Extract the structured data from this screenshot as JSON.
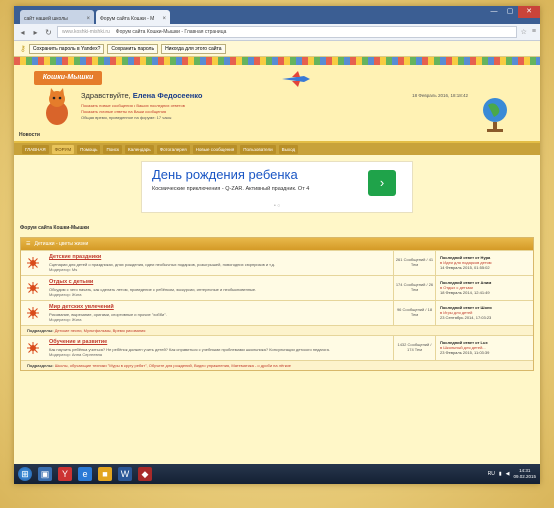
{
  "browser": {
    "tabs": [
      {
        "label": "сайт нашей школы",
        "active": false
      },
      {
        "label": "Форум сайта Кошки - М",
        "active": true
      }
    ],
    "address": {
      "host": "www.koshki-mishki.ru",
      "title": "Форум сайта Кошки-Мышки - Главная страница"
    },
    "password_bar": {
      "prompt": "Сохранить пароль в Yandex?",
      "save_label": "Сохранить пароль",
      "never_label": "Никогда для этого сайта"
    }
  },
  "site": {
    "logo": "Кошки-Мышки",
    "greeting": "Здравствуйте,",
    "user_name": "Елена Федосеенко",
    "links": [
      "Показать новые сообщения • Ваших последних ответов",
      "Показать личные ответы на Ваши сообщения",
      "Общая время, проведенное на форуме: 17 часы"
    ],
    "date": "18 Февраль 2016, 18:18:42",
    "news_label": "Новости",
    "nav": [
      "ГЛАВНАЯ",
      "ФОРУМ",
      "Помощь",
      "Поиск",
      "Календарь",
      "Фотогалерея",
      "Новые сообщения",
      "Пользователи",
      "Выход"
    ],
    "nav_active_index": 1
  },
  "ad": {
    "title": "День рождения ребенка",
    "subtitle": "Космические приключения - Q-ZAR. Активный праздник. От 4",
    "dots": "• ○"
  },
  "forum": {
    "title": "Форум сайта Кошки-Мышки",
    "category": "Детишки - цветы жизни",
    "boards": [
      {
        "title": "Детские праздники",
        "desc": "Сценарии для детей о праздниках, днях рождения, идеи необычных подарков, розыгрышей, новогодних сюрпризов и т.д.",
        "mod": "Модератор: Ms",
        "stats": "261 Сообщений / 41 Тем",
        "last_label": "Последний ответ от Нура",
        "last_link": "в Идеи для подарков детям",
        "last_date": "14 Февраль 2015, 01:55:02"
      },
      {
        "title": "Отдых с детьми",
        "desc": "Обсудим с чего начать, как сделать летом, проведение с ребёнком, экскурсии, интересные и необыкновенные.",
        "mod": "Модератор: Жига",
        "stats": "174 Сообщений / 26 Тем",
        "last_label": "Последний ответ от Аним",
        "last_link": "в Отдых с детьми",
        "last_date": "18 Февраль 2014, 12:41:49"
      },
      {
        "title": "Мир детских увлечений",
        "desc": "Рисование, вырезание, оригами, спортивные и прочие \"хобби\".",
        "mod": "Модератор: Жига",
        "stats": "96 Сообщений / 18 Тем",
        "last_label": "Последний ответ от Шоня",
        "last_link": "в Игры для детей",
        "last_date": "23 Сентябрь 2014, 17:03:23"
      },
      {
        "title": "Обучение и развитие",
        "desc": "Как научить ребёнка учиться? Не ребёнок должен учить детей? Как справиться с учебными проблемами школьника? Консультации детского педагога.",
        "mod": "Модератор: Анна Сергеевна",
        "stats": "1432 Сообщений / 174 Тем",
        "last_label": "Последний ответ от Lux",
        "last_link": "в Школьный для детей...",
        "last_date": "23 Февраль 2015, 11:03:39"
      }
    ],
    "subforums_label": "Подразделы:",
    "subforums_3": "Детские песни, Мультфильмы, Время рисования",
    "subforums_4": "Школы, обучающие техники \"Муры в кругу ребят\", Обучите для рождений, Видео упражнения, Математика - о дроби на лёгкие"
  },
  "taskbar": {
    "time": "14:31",
    "date": "09.02.2015",
    "tray_text": "RU"
  }
}
